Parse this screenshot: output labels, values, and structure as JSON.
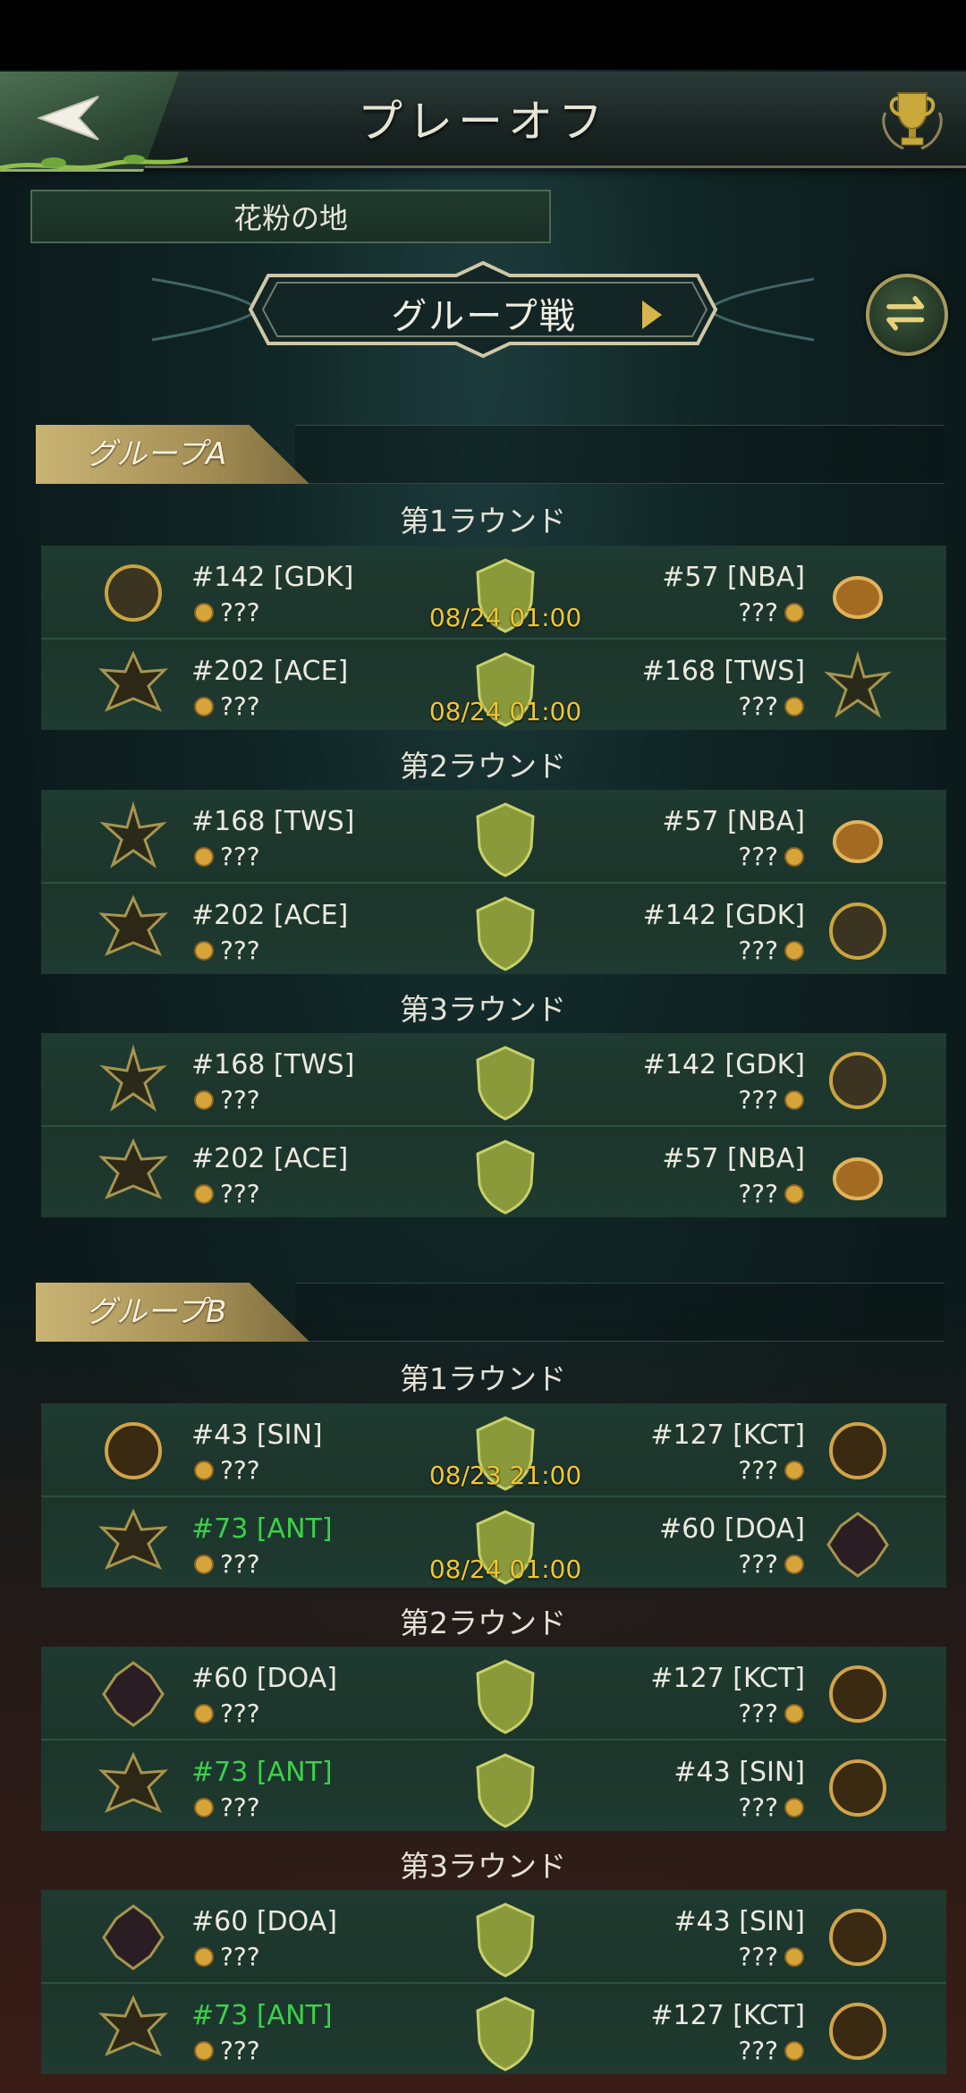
{
  "header": {
    "title": "プレーオフ"
  },
  "region": {
    "label": "花粉の地"
  },
  "selector": {
    "label": "グループ戦"
  },
  "icons": {
    "back": "back-arrow-icon",
    "trophy": "trophy-icon",
    "swap": "swap-arrows-icon",
    "versus": "question-shield-icon",
    "coin": "coin-icon"
  },
  "colors": {
    "accent_gold": "#d7b54e",
    "highlight_green": "#3bd14a",
    "time_yellow": "#f1c631"
  },
  "groups": [
    {
      "name": "グループA",
      "rounds": [
        {
          "label": "第1ラウンド",
          "matches": [
            {
              "left": {
                "name": "#142 [GDK]",
                "score": "???",
                "emblem": "gdk",
                "highlight": false
              },
              "right": {
                "name": "#57 [NBA]",
                "score": "???",
                "emblem": "nba",
                "highlight": false
              },
              "time": "08/24 01:00"
            },
            {
              "left": {
                "name": "#202 [ACE]",
                "score": "???",
                "emblem": "ace",
                "highlight": false
              },
              "right": {
                "name": "#168 [TWS]",
                "score": "???",
                "emblem": "tws",
                "highlight": false
              },
              "time": "08/24 01:00"
            }
          ]
        },
        {
          "label": "第2ラウンド",
          "matches": [
            {
              "left": {
                "name": "#168 [TWS]",
                "score": "???",
                "emblem": "tws",
                "highlight": false
              },
              "right": {
                "name": "#57 [NBA]",
                "score": "???",
                "emblem": "nba",
                "highlight": false
              },
              "time": ""
            },
            {
              "left": {
                "name": "#202 [ACE]",
                "score": "???",
                "emblem": "ace",
                "highlight": false
              },
              "right": {
                "name": "#142 [GDK]",
                "score": "???",
                "emblem": "gdk",
                "highlight": false
              },
              "time": ""
            }
          ]
        },
        {
          "label": "第3ラウンド",
          "matches": [
            {
              "left": {
                "name": "#168 [TWS]",
                "score": "???",
                "emblem": "tws",
                "highlight": false
              },
              "right": {
                "name": "#142 [GDK]",
                "score": "???",
                "emblem": "gdk",
                "highlight": false
              },
              "time": ""
            },
            {
              "left": {
                "name": "#202 [ACE]",
                "score": "???",
                "emblem": "ace",
                "highlight": false
              },
              "right": {
                "name": "#57 [NBA]",
                "score": "???",
                "emblem": "nba",
                "highlight": false
              },
              "time": ""
            }
          ]
        }
      ]
    },
    {
      "name": "グループB",
      "rounds": [
        {
          "label": "第1ラウンド",
          "matches": [
            {
              "left": {
                "name": "#43 [SIN]",
                "score": "???",
                "emblem": "sin",
                "highlight": false
              },
              "right": {
                "name": "#127 [KCT]",
                "score": "???",
                "emblem": "kct",
                "highlight": false
              },
              "time": "08/23 21:00"
            },
            {
              "left": {
                "name": "#73 [ANT]",
                "score": "???",
                "emblem": "ant",
                "highlight": true
              },
              "right": {
                "name": "#60 [DOA]",
                "score": "???",
                "emblem": "doa",
                "highlight": false
              },
              "time": "08/24 01:00"
            }
          ]
        },
        {
          "label": "第2ラウンド",
          "matches": [
            {
              "left": {
                "name": "#60 [DOA]",
                "score": "???",
                "emblem": "doa",
                "highlight": false
              },
              "right": {
                "name": "#127 [KCT]",
                "score": "???",
                "emblem": "kct",
                "highlight": false
              },
              "time": ""
            },
            {
              "left": {
                "name": "#73 [ANT]",
                "score": "???",
                "emblem": "ant",
                "highlight": true
              },
              "right": {
                "name": "#43 [SIN]",
                "score": "???",
                "emblem": "sin",
                "highlight": false
              },
              "time": ""
            }
          ]
        },
        {
          "label": "第3ラウンド",
          "matches": [
            {
              "left": {
                "name": "#60 [DOA]",
                "score": "???",
                "emblem": "doa",
                "highlight": false
              },
              "right": {
                "name": "#43 [SIN]",
                "score": "???",
                "emblem": "sin",
                "highlight": false
              },
              "time": ""
            },
            {
              "left": {
                "name": "#73 [ANT]",
                "score": "???",
                "emblem": "ant",
                "highlight": true
              },
              "right": {
                "name": "#127 [KCT]",
                "score": "???",
                "emblem": "kct",
                "highlight": false
              },
              "time": ""
            }
          ]
        }
      ]
    }
  ]
}
